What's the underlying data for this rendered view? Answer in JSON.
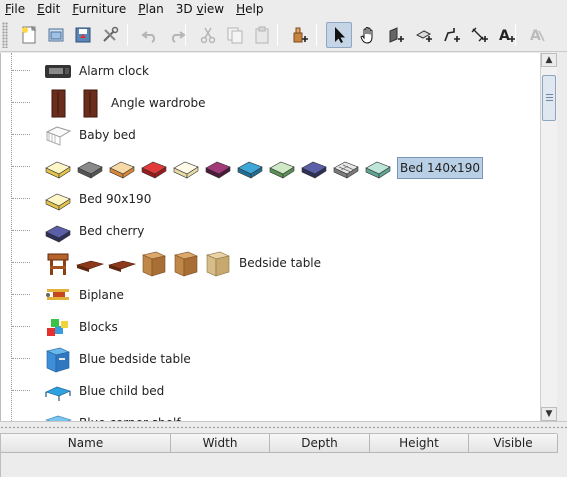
{
  "menubar": {
    "items": [
      {
        "label": "File",
        "mnemonic": "F",
        "rest": "ile"
      },
      {
        "label": "Edit",
        "mnemonic": "E",
        "rest": "dit"
      },
      {
        "label": "Furniture",
        "mnemonic": "F",
        "rest": "urniture"
      },
      {
        "label": "Plan",
        "mnemonic": "P",
        "rest": "lan"
      },
      {
        "label": "3D view",
        "mnemonic": "",
        "rest": "3D view"
      },
      {
        "label": "Help",
        "mnemonic": "H",
        "rest": "elp"
      }
    ]
  },
  "toolbar": {
    "buttons": [
      {
        "name": "new-home-icon",
        "enabled": true
      },
      {
        "name": "open-icon",
        "enabled": true
      },
      {
        "name": "save-icon",
        "enabled": true
      },
      {
        "name": "preferences-icon",
        "enabled": true
      },
      {
        "name": "undo-icon",
        "enabled": false
      },
      {
        "name": "redo-icon",
        "enabled": false
      },
      {
        "name": "cut-icon",
        "enabled": false
      },
      {
        "name": "copy-icon",
        "enabled": false
      },
      {
        "name": "paste-icon",
        "enabled": false
      },
      {
        "name": "add-furniture-icon",
        "enabled": true
      },
      {
        "name": "select-mode-icon",
        "enabled": true,
        "pressed": true
      },
      {
        "name": "pan-mode-icon",
        "enabled": true
      },
      {
        "name": "create-walls-icon",
        "enabled": true
      },
      {
        "name": "create-rooms-icon",
        "enabled": true
      },
      {
        "name": "create-polylines-icon",
        "enabled": true
      },
      {
        "name": "create-dimensions-icon",
        "enabled": true
      },
      {
        "name": "add-text-icon",
        "enabled": true
      },
      {
        "name": "text-style-icon",
        "enabled": false
      },
      {
        "name": "text-size-icon",
        "enabled": false
      }
    ]
  },
  "catalog": {
    "rows": [
      {
        "label": "Alarm clock",
        "icons": [
          "alarm-clock"
        ],
        "selected": false
      },
      {
        "label": "Angle wardrobe",
        "icons": [
          "wardrobe",
          "wardrobe"
        ],
        "selected": false
      },
      {
        "label": "Baby bed",
        "icons": [
          "baby-bed"
        ],
        "selected": false
      },
      {
        "label": "Bed 140x190",
        "icons": [
          "bed-yellow",
          "bed-grey",
          "bed-orange",
          "bed-red",
          "bed-cream",
          "bed-purple",
          "bed-blue",
          "bed-green",
          "bed-navy",
          "bed-checked",
          "bed-teal"
        ],
        "selected": true
      },
      {
        "label": "Bed 90x190",
        "icons": [
          "bed-yellow"
        ],
        "selected": false
      },
      {
        "label": "Bed cherry",
        "icons": [
          "bed-navy"
        ],
        "selected": false
      },
      {
        "label": "Bedside table",
        "icons": [
          "bedside-cherry",
          "bedside-low",
          "bedside-low",
          "bedside-wood",
          "bedside-wood",
          "bedside-wicker"
        ],
        "selected": false
      },
      {
        "label": "Biplane",
        "icons": [
          "biplane"
        ],
        "selected": false
      },
      {
        "label": "Blocks",
        "icons": [
          "blocks"
        ],
        "selected": false
      },
      {
        "label": "Blue bedside table",
        "icons": [
          "blue-bedside"
        ],
        "selected": false
      },
      {
        "label": "Blue child bed",
        "icons": [
          "blue-child-bed"
        ],
        "selected": false
      },
      {
        "label": "Blue corner shelf",
        "icons": [
          "blue-shelf"
        ],
        "selected": false
      }
    ]
  },
  "furniture_table": {
    "columns": [
      "Name",
      "Width",
      "Depth",
      "Height",
      "Visible"
    ]
  }
}
